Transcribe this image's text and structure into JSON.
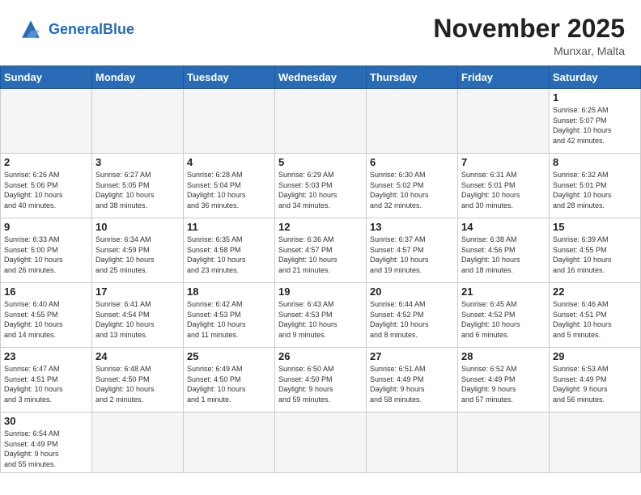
{
  "header": {
    "logo_general": "General",
    "logo_blue": "Blue",
    "month_title": "November 2025",
    "location": "Munxar, Malta"
  },
  "days_of_week": [
    "Sunday",
    "Monday",
    "Tuesday",
    "Wednesday",
    "Thursday",
    "Friday",
    "Saturday"
  ],
  "weeks": [
    [
      {
        "day": "",
        "info": ""
      },
      {
        "day": "",
        "info": ""
      },
      {
        "day": "",
        "info": ""
      },
      {
        "day": "",
        "info": ""
      },
      {
        "day": "",
        "info": ""
      },
      {
        "day": "",
        "info": ""
      },
      {
        "day": "1",
        "info": "Sunrise: 6:25 AM\nSunset: 5:07 PM\nDaylight: 10 hours\nand 42 minutes."
      }
    ],
    [
      {
        "day": "2",
        "info": "Sunrise: 6:26 AM\nSunset: 5:06 PM\nDaylight: 10 hours\nand 40 minutes."
      },
      {
        "day": "3",
        "info": "Sunrise: 6:27 AM\nSunset: 5:05 PM\nDaylight: 10 hours\nand 38 minutes."
      },
      {
        "day": "4",
        "info": "Sunrise: 6:28 AM\nSunset: 5:04 PM\nDaylight: 10 hours\nand 36 minutes."
      },
      {
        "day": "5",
        "info": "Sunrise: 6:29 AM\nSunset: 5:03 PM\nDaylight: 10 hours\nand 34 minutes."
      },
      {
        "day": "6",
        "info": "Sunrise: 6:30 AM\nSunset: 5:02 PM\nDaylight: 10 hours\nand 32 minutes."
      },
      {
        "day": "7",
        "info": "Sunrise: 6:31 AM\nSunset: 5:01 PM\nDaylight: 10 hours\nand 30 minutes."
      },
      {
        "day": "8",
        "info": "Sunrise: 6:32 AM\nSunset: 5:01 PM\nDaylight: 10 hours\nand 28 minutes."
      }
    ],
    [
      {
        "day": "9",
        "info": "Sunrise: 6:33 AM\nSunset: 5:00 PM\nDaylight: 10 hours\nand 26 minutes."
      },
      {
        "day": "10",
        "info": "Sunrise: 6:34 AM\nSunset: 4:59 PM\nDaylight: 10 hours\nand 25 minutes."
      },
      {
        "day": "11",
        "info": "Sunrise: 6:35 AM\nSunset: 4:58 PM\nDaylight: 10 hours\nand 23 minutes."
      },
      {
        "day": "12",
        "info": "Sunrise: 6:36 AM\nSunset: 4:57 PM\nDaylight: 10 hours\nand 21 minutes."
      },
      {
        "day": "13",
        "info": "Sunrise: 6:37 AM\nSunset: 4:57 PM\nDaylight: 10 hours\nand 19 minutes."
      },
      {
        "day": "14",
        "info": "Sunrise: 6:38 AM\nSunset: 4:56 PM\nDaylight: 10 hours\nand 18 minutes."
      },
      {
        "day": "15",
        "info": "Sunrise: 6:39 AM\nSunset: 4:55 PM\nDaylight: 10 hours\nand 16 minutes."
      }
    ],
    [
      {
        "day": "16",
        "info": "Sunrise: 6:40 AM\nSunset: 4:55 PM\nDaylight: 10 hours\nand 14 minutes."
      },
      {
        "day": "17",
        "info": "Sunrise: 6:41 AM\nSunset: 4:54 PM\nDaylight: 10 hours\nand 13 minutes."
      },
      {
        "day": "18",
        "info": "Sunrise: 6:42 AM\nSunset: 4:53 PM\nDaylight: 10 hours\nand 11 minutes."
      },
      {
        "day": "19",
        "info": "Sunrise: 6:43 AM\nSunset: 4:53 PM\nDaylight: 10 hours\nand 9 minutes."
      },
      {
        "day": "20",
        "info": "Sunrise: 6:44 AM\nSunset: 4:52 PM\nDaylight: 10 hours\nand 8 minutes."
      },
      {
        "day": "21",
        "info": "Sunrise: 6:45 AM\nSunset: 4:52 PM\nDaylight: 10 hours\nand 6 minutes."
      },
      {
        "day": "22",
        "info": "Sunrise: 6:46 AM\nSunset: 4:51 PM\nDaylight: 10 hours\nand 5 minutes."
      }
    ],
    [
      {
        "day": "23",
        "info": "Sunrise: 6:47 AM\nSunset: 4:51 PM\nDaylight: 10 hours\nand 3 minutes."
      },
      {
        "day": "24",
        "info": "Sunrise: 6:48 AM\nSunset: 4:50 PM\nDaylight: 10 hours\nand 2 minutes."
      },
      {
        "day": "25",
        "info": "Sunrise: 6:49 AM\nSunset: 4:50 PM\nDaylight: 10 hours\nand 1 minute."
      },
      {
        "day": "26",
        "info": "Sunrise: 6:50 AM\nSunset: 4:50 PM\nDaylight: 9 hours\nand 59 minutes."
      },
      {
        "day": "27",
        "info": "Sunrise: 6:51 AM\nSunset: 4:49 PM\nDaylight: 9 hours\nand 58 minutes."
      },
      {
        "day": "28",
        "info": "Sunrise: 6:52 AM\nSunset: 4:49 PM\nDaylight: 9 hours\nand 57 minutes."
      },
      {
        "day": "29",
        "info": "Sunrise: 6:53 AM\nSunset: 4:49 PM\nDaylight: 9 hours\nand 56 minutes."
      }
    ],
    [
      {
        "day": "30",
        "info": "Sunrise: 6:54 AM\nSunset: 4:49 PM\nDaylight: 9 hours\nand 55 minutes."
      },
      {
        "day": "",
        "info": ""
      },
      {
        "day": "",
        "info": ""
      },
      {
        "day": "",
        "info": ""
      },
      {
        "day": "",
        "info": ""
      },
      {
        "day": "",
        "info": ""
      },
      {
        "day": "",
        "info": ""
      }
    ]
  ]
}
